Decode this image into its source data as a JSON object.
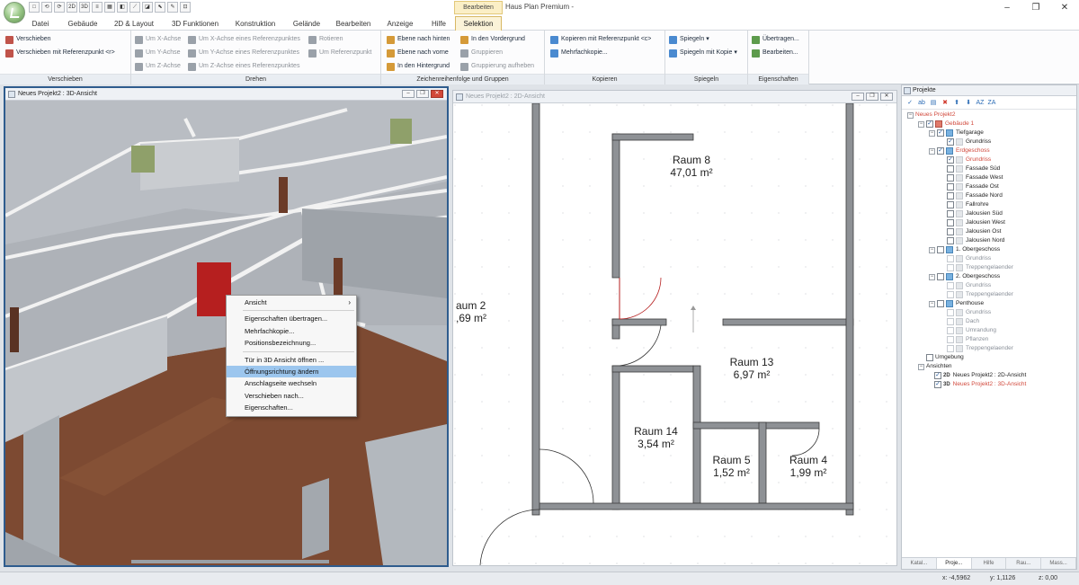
{
  "app": {
    "title": "Haus Plan Premium -"
  },
  "qat": [
    "□",
    "⟲",
    "⟳",
    "2D",
    "3D",
    "≡",
    "▦",
    "◧",
    "⟋",
    "◪",
    "⬉",
    "✎",
    "⊡"
  ],
  "window_controls": {
    "minimize": "–",
    "maximize": "❐",
    "close": "✕"
  },
  "ribbon": {
    "context_label": "Bearbeiten",
    "tabs": [
      "Datei",
      "Gebäude",
      "2D & Layout",
      "3D Funktionen",
      "Konstruktion",
      "Gelände",
      "Bearbeiten",
      "Anzeige",
      "Hilfe",
      "Selektion"
    ],
    "active_tab": "Selektion",
    "groups": {
      "verschieben": {
        "label": "Verschieben",
        "items": [
          "Verschieben",
          "Verschieben mit Referenzpunkt <r>"
        ]
      },
      "drehen": {
        "label": "Drehen",
        "items": [
          "Um X-Achse",
          "Um Y-Achse",
          "Um Z-Achse",
          "Um X-Achse eines Referenzpunktes",
          "Um Y-Achse eines Referenzpunktes",
          "Um Z-Achse eines Referenzpunktes",
          "Rotieren",
          "Um Referenzpunkt"
        ]
      },
      "zeichen": {
        "label": "Zeichenreihenfolge und Gruppen",
        "items": [
          "Ebene nach hinten",
          "Ebene nach vorne",
          "In den Hintergrund",
          "In den Vordergrund",
          "Gruppieren",
          "Gruppierung aufheben"
        ]
      },
      "kopieren": {
        "label": "Kopieren",
        "items": [
          "Kopieren mit Referenzpunkt <c>",
          "Mehrfachkopie..."
        ]
      },
      "spiegeln": {
        "label": "Spiegeln",
        "items": [
          "Spiegeln",
          "Spiegeln mit Kopie"
        ]
      },
      "eigenschaften": {
        "label": "Eigenschaften",
        "items": [
          "Übertragen...",
          "Bearbeiten..."
        ]
      }
    }
  },
  "view3d": {
    "title": "Neues Projekt2 : 3D-Ansicht",
    "context_menu": {
      "items": [
        "Ansicht",
        "Eigenschaften übertragen...",
        "Mehrfachkopie...",
        "Positionsbezeichnung...",
        "Tür in 3D Ansicht öffnen ...",
        "Öffnungsrichtung ändern",
        "Anschlagseite wechseln",
        "Verschieben nach...",
        "Eigenschaften..."
      ],
      "highlighted": "Öffnungsrichtung ändern"
    }
  },
  "view2d": {
    "title": "Neues Projekt2 : 2D-Ansicht",
    "rooms": [
      {
        "name": "Raum 8",
        "area": "47,01 m²"
      },
      {
        "name": "aum 2",
        "area": ",69 m²"
      },
      {
        "name": "Raum 13",
        "area": "6,97 m²"
      },
      {
        "name": "Raum 14",
        "area": "3,54 m²"
      },
      {
        "name": "Raum 5",
        "area": "1,52 m²"
      },
      {
        "name": "Raum 4",
        "area": "1,99 m²"
      }
    ]
  },
  "projects": {
    "title": "Projekte",
    "toolbar": [
      "✓",
      "ab",
      "▤",
      "✖",
      "⬆",
      "⬇",
      "AZ",
      "ZA"
    ],
    "tree": {
      "root": "Neues Projekt2",
      "building": "Gebäude 1",
      "tiefgarage": "Tiefgarage",
      "grundriss": "Grundriss",
      "erdgeschoss": "Erdgeschoss",
      "eg_items": [
        "Grundriss",
        "Fassade Süd",
        "Fassade West",
        "Fassade Ost",
        "Fassade Nord",
        "Fallrohre",
        "Jalousien Süd",
        "Jalousien West",
        "Jalousien Ost",
        "Jalousien Nord"
      ],
      "og1": "1. Obergeschoss",
      "og1_items": [
        "Grundriss",
        "Treppengelaender"
      ],
      "og2": "2. Obergeschoss",
      "og2_items": [
        "Grundriss",
        "Treppengelaender"
      ],
      "penthouse": "Penthouse",
      "ph_items": [
        "Grundriss",
        "Dach",
        "Umrandung",
        "Pflanzen",
        "Treppengelaender"
      ],
      "umgebung": "Umgebung",
      "ansichten": "Ansichten",
      "view_2d_tag": "2D",
      "view_3d_tag": "3D",
      "view_2d": "Neues Projekt2 : 2D-Ansicht",
      "view_3d": "Neues Projekt2 : 3D-Ansicht"
    },
    "bottom_tabs": [
      "Katal...",
      "Proje...",
      "Hilfe",
      "Rau...",
      "Mass..."
    ]
  },
  "status": {
    "x": "x: -4,5962",
    "y": "y: 1,1126",
    "z": "z: 0,00"
  },
  "colors": {
    "accent": "#2e5c8e",
    "door_red": "#b61f1f",
    "floor": "#7d4a32",
    "selected_tab": "#fbf3d8"
  }
}
